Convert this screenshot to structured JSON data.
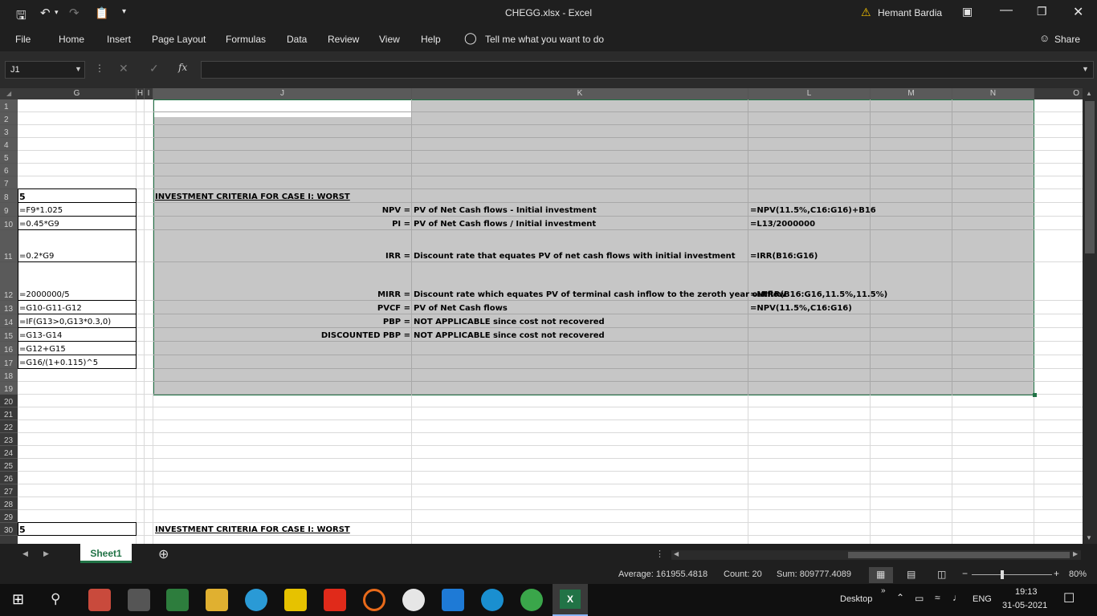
{
  "titlebar": {
    "title": "CHEGG.xlsx  -  Excel",
    "user": "Hemant Bardia"
  },
  "ribbon": {
    "tabs": [
      "File",
      "Home",
      "Insert",
      "Page Layout",
      "Formulas",
      "Data",
      "Review",
      "View",
      "Help"
    ],
    "tell_me": "Tell me what you want to do",
    "share": "Share"
  },
  "formula_bar": {
    "name_box": "J1",
    "formula": "",
    "fx": "fx"
  },
  "columns": [
    "G",
    "H",
    "I",
    "J",
    "K",
    "L",
    "M",
    "N",
    "O"
  ],
  "rows": [
    "1",
    "2",
    "3",
    "4",
    "5",
    "6",
    "7",
    "8",
    "9",
    "10",
    "11",
    "12",
    "13",
    "14",
    "15",
    "16",
    "17",
    "18",
    "19",
    "20",
    "21",
    "22",
    "23",
    "24",
    "25",
    "26",
    "27",
    "28",
    "29",
    "30"
  ],
  "cells": {
    "G8": "5",
    "G9": "=F9*1.025",
    "G10": "=0.45*G9",
    "G11": "=0.2*G9",
    "G12": "=2000000/5",
    "G13": "=G10-G11-G12",
    "G14": "=IF(G13>0,G13*0.3,0)",
    "G15": "=G13-G14",
    "G16": "=G12+G15",
    "G17": "=G16/(1+0.115)^5",
    "J8": "INVESTMENT CRITERIA FOR CASE I: WORST",
    "J9": "NPV =",
    "J10": "PI =",
    "J11": "IRR =",
    "J12": "MIRR =",
    "J13": "PVCF =",
    "J14": "PBP =",
    "J15": "DISCOUNTED PBP =",
    "K9": "PV of Net Cash flows - Initial investment",
    "K10": "PV of Net Cash flows / Initial investment",
    "K11": "Discount rate that equates PV of net cash flows with initial investment",
    "K12": "Discount rate which equates PV of terminal cash inflow to the zeroth year outflow",
    "K13": "PV of Net Cash flows",
    "K14": "NOT APPLICABLE since cost not recovered",
    "K15": "NOT APPLICABLE since cost not recovered",
    "L9": "=NPV(11.5%,C16:G16)+B16",
    "L10": "=L13/2000000",
    "L11": "=IRR(B16:G16)",
    "L12": "=MIRR(B16:G16,11.5%,11.5%)",
    "L13": "=NPV(11.5%,C16:G16)",
    "G30": "5",
    "J30": "INVESTMENT CRITERIA FOR CASE I: WORST"
  },
  "sheet": {
    "tab": "Sheet1"
  },
  "status": {
    "average": "Average: 161955.4818",
    "count": "Count: 20",
    "sum": "Sum: 809777.4089",
    "zoom": "80%"
  },
  "taskbar": {
    "desktop": "Desktop",
    "lang": "ENG",
    "time": "19:13",
    "date": "31-05-2021"
  },
  "colors": {
    "accent": "#217346",
    "selection": "#c6c6c6",
    "chrome": "#1f1f1f"
  }
}
